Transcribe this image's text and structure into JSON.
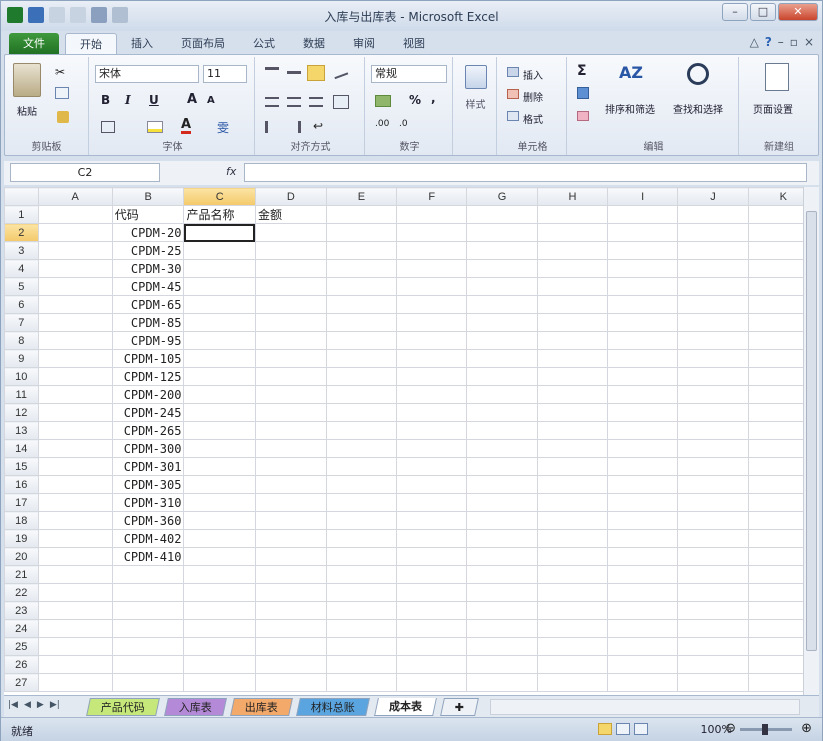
{
  "window": {
    "title": "入库与出库表 - Microsoft Excel",
    "buttons": {
      "minimize": "–",
      "maximize": "□",
      "close": "✕"
    }
  },
  "tabs": [
    "文件",
    "开始",
    "插入",
    "页面布局",
    "公式",
    "数据",
    "审阅",
    "视图"
  ],
  "active_tab": "开始",
  "ribbon": {
    "clipboard": {
      "paste": "粘贴",
      "label": "剪贴板"
    },
    "font": {
      "name": "宋体",
      "size": "11",
      "label": "字体",
      "bold": "B",
      "italic": "I",
      "underline": "U",
      "grow": "A",
      "shrink": "A",
      "wen": "雯"
    },
    "alignment": {
      "label": "对齐方式"
    },
    "number": {
      "format": "常规",
      "percent": "%",
      "comma": ",",
      "label": "数字"
    },
    "styles": {
      "label": "样式"
    },
    "cells": {
      "insert": "插入",
      "delete": "删除",
      "format": "格式",
      "label": "单元格"
    },
    "editing": {
      "sigma": "Σ",
      "sort": "排序和筛选",
      "find": "查找和选择",
      "label": "编辑"
    },
    "newgroup": {
      "page_setup": "页面设置",
      "label": "新建组"
    }
  },
  "formula_bar": {
    "name_box": "C2",
    "fx": "fx",
    "formula": ""
  },
  "columns": [
    "A",
    "B",
    "C",
    "D",
    "E",
    "F",
    "G",
    "H",
    "I",
    "J",
    "K"
  ],
  "selected_column": "C",
  "selected_row": "2",
  "rows": [
    {
      "n": "1",
      "A": "",
      "B": "代码",
      "C": "产品名称",
      "D": "金额"
    },
    {
      "n": "2",
      "A": "",
      "B": "CPDM-20",
      "C": "",
      "D": ""
    },
    {
      "n": "3",
      "A": "",
      "B": "CPDM-25",
      "C": "",
      "D": ""
    },
    {
      "n": "4",
      "A": "",
      "B": "CPDM-30",
      "C": "",
      "D": ""
    },
    {
      "n": "5",
      "A": "",
      "B": "CPDM-45",
      "C": "",
      "D": ""
    },
    {
      "n": "6",
      "A": "",
      "B": "CPDM-65",
      "C": "",
      "D": ""
    },
    {
      "n": "7",
      "A": "",
      "B": "CPDM-85",
      "C": "",
      "D": ""
    },
    {
      "n": "8",
      "A": "",
      "B": "CPDM-95",
      "C": "",
      "D": ""
    },
    {
      "n": "9",
      "A": "",
      "B": "CPDM-105",
      "C": "",
      "D": ""
    },
    {
      "n": "10",
      "A": "",
      "B": "CPDM-125",
      "C": "",
      "D": ""
    },
    {
      "n": "11",
      "A": "",
      "B": "CPDM-200",
      "C": "",
      "D": ""
    },
    {
      "n": "12",
      "A": "",
      "B": "CPDM-245",
      "C": "",
      "D": ""
    },
    {
      "n": "13",
      "A": "",
      "B": "CPDM-265",
      "C": "",
      "D": ""
    },
    {
      "n": "14",
      "A": "",
      "B": "CPDM-300",
      "C": "",
      "D": ""
    },
    {
      "n": "15",
      "A": "",
      "B": "CPDM-301",
      "C": "",
      "D": ""
    },
    {
      "n": "16",
      "A": "",
      "B": "CPDM-305",
      "C": "",
      "D": ""
    },
    {
      "n": "17",
      "A": "",
      "B": "CPDM-310",
      "C": "",
      "D": ""
    },
    {
      "n": "18",
      "A": "",
      "B": "CPDM-360",
      "C": "",
      "D": ""
    },
    {
      "n": "19",
      "A": "",
      "B": "CPDM-402",
      "C": "",
      "D": ""
    },
    {
      "n": "20",
      "A": "",
      "B": "CPDM-410",
      "C": "",
      "D": ""
    },
    {
      "n": "21",
      "A": "",
      "B": "",
      "C": "",
      "D": ""
    },
    {
      "n": "22",
      "A": "",
      "B": "",
      "C": "",
      "D": ""
    },
    {
      "n": "23",
      "A": "",
      "B": "",
      "C": "",
      "D": ""
    },
    {
      "n": "24",
      "A": "",
      "B": "",
      "C": "",
      "D": ""
    },
    {
      "n": "25",
      "A": "",
      "B": "",
      "C": "",
      "D": ""
    },
    {
      "n": "26",
      "A": "",
      "B": "",
      "C": "",
      "D": ""
    },
    {
      "n": "27",
      "A": "",
      "B": "",
      "C": "",
      "D": ""
    }
  ],
  "sheet_tabs": [
    {
      "name": "产品代码",
      "color": "#c6e87a"
    },
    {
      "name": "入库表",
      "color": "#b48ad8"
    },
    {
      "name": "出库表",
      "color": "#f2a96a"
    },
    {
      "name": "材料总账",
      "color": "#5aa5e0"
    },
    {
      "name": "成本表",
      "color": "#ffffff"
    }
  ],
  "active_sheet": "成本表",
  "status": {
    "ready": "就绪",
    "zoom": "100%"
  }
}
